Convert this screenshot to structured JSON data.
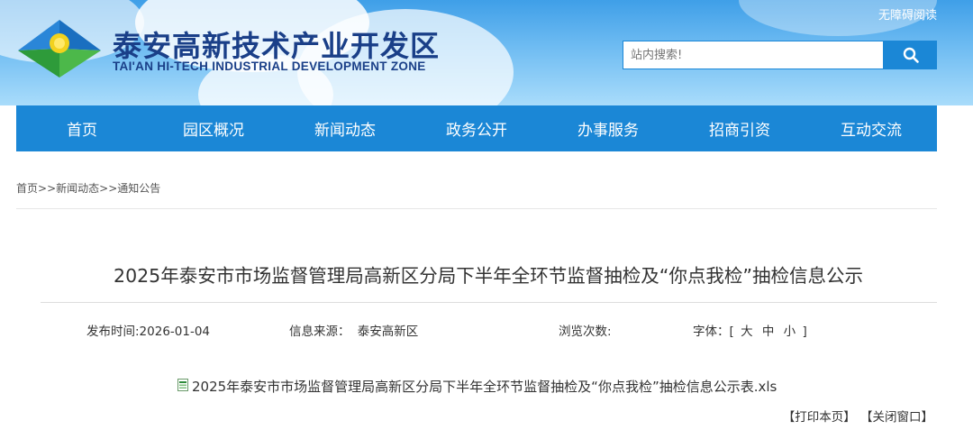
{
  "header": {
    "logo_cn": "泰安高新技术产业开发区",
    "logo_en": "TAI'AN HI-TECH INDUSTRIAL DEVELOPMENT ZONE",
    "accessibility_label": "无障碍阅读",
    "search_placeholder": "站内搜索!",
    "brand_color": "#1b87d6"
  },
  "nav": {
    "items": [
      {
        "label": "首页"
      },
      {
        "label": "园区概况"
      },
      {
        "label": "新闻动态"
      },
      {
        "label": "政务公开"
      },
      {
        "label": "办事服务"
      },
      {
        "label": "招商引资"
      },
      {
        "label": "互动交流"
      }
    ]
  },
  "breadcrumb": {
    "home": "首页",
    "sep": ">>",
    "level1": "新闻动态",
    "level2": "通知公告"
  },
  "article": {
    "title": "2025年泰安市市场监督管理局高新区分局下半年全环节监督抽检及“你点我检”抽检信息公示",
    "publish_time": "发布时间:2026-01-04",
    "source_label": "信息来源：",
    "source_value": "泰安高新区",
    "views_label": "浏览次数:",
    "font_label": "字体：[",
    "font_large": "大",
    "font_medium": "中",
    "font_small": "小",
    "font_close": "]",
    "attachment": "2025年泰安市市场监督管理局高新区分局下半年全环节监督抽检及“你点我检”抽检信息公示表.xls"
  },
  "actions": {
    "print": "【打印本页】",
    "close": "【关闭窗口】"
  }
}
